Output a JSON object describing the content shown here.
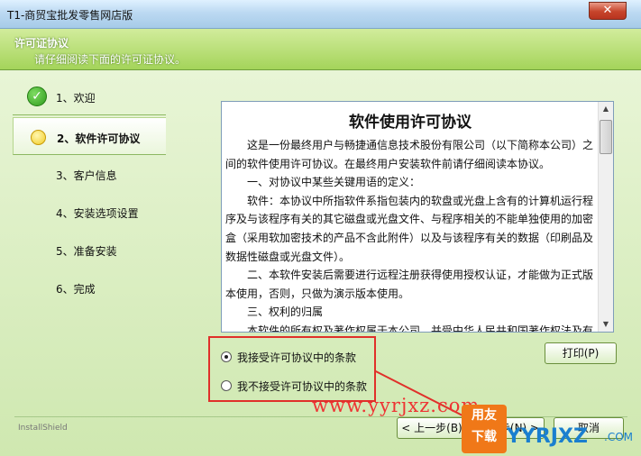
{
  "window": {
    "title": "T1-商贸宝批发零售网店版",
    "close_glyph": "✕"
  },
  "header": {
    "title": "许可证协议",
    "subtitle": "请仔细阅读下面的许可证协议。"
  },
  "steps": [
    {
      "label": "1、欢迎",
      "state": "done"
    },
    {
      "label": "2、软件许可协议",
      "state": "active"
    },
    {
      "label": "3、客户信息",
      "state": "pending"
    },
    {
      "label": "4、安装选项设置",
      "state": "pending"
    },
    {
      "label": "5、准备安装",
      "state": "pending"
    },
    {
      "label": "6、完成",
      "state": "pending"
    }
  ],
  "license": {
    "title": "软件使用许可协议",
    "paragraphs": [
      "　　这是一份最终用户与畅捷通信息技术股份有限公司（以下简称本公司）之间的软件使用许可协议。在最终用户安装软件前请仔细阅读本协议。",
      "　　一、对协议中某些关键用语的定义：",
      "　　软件：本协议中所指软件系指包装内的软盘或光盘上含有的计算机运行程序及与该程序有关的其它磁盘或光盘文件、与程序相关的不能单独使用的加密盒（采用软加密技术的产品不含此附件）以及与该程序有关的数据（印刷品及数据性磁盘或光盘文件）。",
      "　　二、本软件安装后需要进行远程注册获得使用授权认证，才能做为正式版本使用，否则，只做为演示版本使用。",
      "　　三、权利的归属",
      "　　本软件的所有权及著作权属于本公司，并受中华人民共和国著作权法及有关法律和国际条约的保护。因此，您必须象对待其它受"
    ]
  },
  "options": {
    "accept": "我接受许可协议中的条款",
    "decline": "我不接受许可协议中的条款",
    "selected": "accept"
  },
  "buttons": {
    "print": "打印(P)",
    "back": "< 上一步(B)",
    "next": "下一步(N) >",
    "cancel": "取消"
  },
  "footer": {
    "brand": "InstallShield"
  },
  "watermark": {
    "url": "www.yyrjxz.com",
    "logo_top": "用友",
    "logo_bottom": "下载",
    "site": "YYRJXZ",
    "tld": ".COM"
  },
  "colors": {
    "accent_green": "#a4d45a",
    "highlight_red": "#e0302a"
  }
}
